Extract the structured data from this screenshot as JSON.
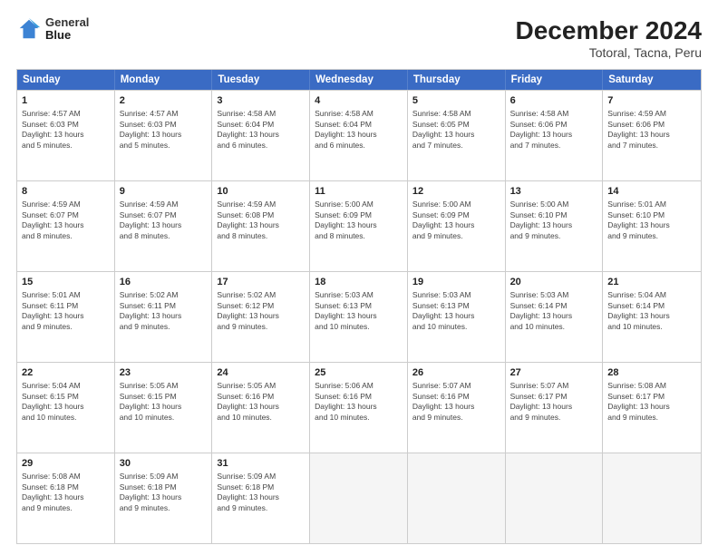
{
  "header": {
    "logo_line1": "General",
    "logo_line2": "Blue",
    "title": "December 2024",
    "subtitle": "Totoral, Tacna, Peru"
  },
  "weekdays": [
    "Sunday",
    "Monday",
    "Tuesday",
    "Wednesday",
    "Thursday",
    "Friday",
    "Saturday"
  ],
  "rows": [
    [
      {
        "day": "1",
        "lines": [
          "Sunrise: 4:57 AM",
          "Sunset: 6:03 PM",
          "Daylight: 13 hours",
          "and 5 minutes."
        ]
      },
      {
        "day": "2",
        "lines": [
          "Sunrise: 4:57 AM",
          "Sunset: 6:03 PM",
          "Daylight: 13 hours",
          "and 5 minutes."
        ]
      },
      {
        "day": "3",
        "lines": [
          "Sunrise: 4:58 AM",
          "Sunset: 6:04 PM",
          "Daylight: 13 hours",
          "and 6 minutes."
        ]
      },
      {
        "day": "4",
        "lines": [
          "Sunrise: 4:58 AM",
          "Sunset: 6:04 PM",
          "Daylight: 13 hours",
          "and 6 minutes."
        ]
      },
      {
        "day": "5",
        "lines": [
          "Sunrise: 4:58 AM",
          "Sunset: 6:05 PM",
          "Daylight: 13 hours",
          "and 7 minutes."
        ]
      },
      {
        "day": "6",
        "lines": [
          "Sunrise: 4:58 AM",
          "Sunset: 6:06 PM",
          "Daylight: 13 hours",
          "and 7 minutes."
        ]
      },
      {
        "day": "7",
        "lines": [
          "Sunrise: 4:59 AM",
          "Sunset: 6:06 PM",
          "Daylight: 13 hours",
          "and 7 minutes."
        ]
      }
    ],
    [
      {
        "day": "8",
        "lines": [
          "Sunrise: 4:59 AM",
          "Sunset: 6:07 PM",
          "Daylight: 13 hours",
          "and 8 minutes."
        ]
      },
      {
        "day": "9",
        "lines": [
          "Sunrise: 4:59 AM",
          "Sunset: 6:07 PM",
          "Daylight: 13 hours",
          "and 8 minutes."
        ]
      },
      {
        "day": "10",
        "lines": [
          "Sunrise: 4:59 AM",
          "Sunset: 6:08 PM",
          "Daylight: 13 hours",
          "and 8 minutes."
        ]
      },
      {
        "day": "11",
        "lines": [
          "Sunrise: 5:00 AM",
          "Sunset: 6:09 PM",
          "Daylight: 13 hours",
          "and 8 minutes."
        ]
      },
      {
        "day": "12",
        "lines": [
          "Sunrise: 5:00 AM",
          "Sunset: 6:09 PM",
          "Daylight: 13 hours",
          "and 9 minutes."
        ]
      },
      {
        "day": "13",
        "lines": [
          "Sunrise: 5:00 AM",
          "Sunset: 6:10 PM",
          "Daylight: 13 hours",
          "and 9 minutes."
        ]
      },
      {
        "day": "14",
        "lines": [
          "Sunrise: 5:01 AM",
          "Sunset: 6:10 PM",
          "Daylight: 13 hours",
          "and 9 minutes."
        ]
      }
    ],
    [
      {
        "day": "15",
        "lines": [
          "Sunrise: 5:01 AM",
          "Sunset: 6:11 PM",
          "Daylight: 13 hours",
          "and 9 minutes."
        ]
      },
      {
        "day": "16",
        "lines": [
          "Sunrise: 5:02 AM",
          "Sunset: 6:11 PM",
          "Daylight: 13 hours",
          "and 9 minutes."
        ]
      },
      {
        "day": "17",
        "lines": [
          "Sunrise: 5:02 AM",
          "Sunset: 6:12 PM",
          "Daylight: 13 hours",
          "and 9 minutes."
        ]
      },
      {
        "day": "18",
        "lines": [
          "Sunrise: 5:03 AM",
          "Sunset: 6:13 PM",
          "Daylight: 13 hours",
          "and 10 minutes."
        ]
      },
      {
        "day": "19",
        "lines": [
          "Sunrise: 5:03 AM",
          "Sunset: 6:13 PM",
          "Daylight: 13 hours",
          "and 10 minutes."
        ]
      },
      {
        "day": "20",
        "lines": [
          "Sunrise: 5:03 AM",
          "Sunset: 6:14 PM",
          "Daylight: 13 hours",
          "and 10 minutes."
        ]
      },
      {
        "day": "21",
        "lines": [
          "Sunrise: 5:04 AM",
          "Sunset: 6:14 PM",
          "Daylight: 13 hours",
          "and 10 minutes."
        ]
      }
    ],
    [
      {
        "day": "22",
        "lines": [
          "Sunrise: 5:04 AM",
          "Sunset: 6:15 PM",
          "Daylight: 13 hours",
          "and 10 minutes."
        ]
      },
      {
        "day": "23",
        "lines": [
          "Sunrise: 5:05 AM",
          "Sunset: 6:15 PM",
          "Daylight: 13 hours",
          "and 10 minutes."
        ]
      },
      {
        "day": "24",
        "lines": [
          "Sunrise: 5:05 AM",
          "Sunset: 6:16 PM",
          "Daylight: 13 hours",
          "and 10 minutes."
        ]
      },
      {
        "day": "25",
        "lines": [
          "Sunrise: 5:06 AM",
          "Sunset: 6:16 PM",
          "Daylight: 13 hours",
          "and 10 minutes."
        ]
      },
      {
        "day": "26",
        "lines": [
          "Sunrise: 5:07 AM",
          "Sunset: 6:16 PM",
          "Daylight: 13 hours",
          "and 9 minutes."
        ]
      },
      {
        "day": "27",
        "lines": [
          "Sunrise: 5:07 AM",
          "Sunset: 6:17 PM",
          "Daylight: 13 hours",
          "and 9 minutes."
        ]
      },
      {
        "day": "28",
        "lines": [
          "Sunrise: 5:08 AM",
          "Sunset: 6:17 PM",
          "Daylight: 13 hours",
          "and 9 minutes."
        ]
      }
    ],
    [
      {
        "day": "29",
        "lines": [
          "Sunrise: 5:08 AM",
          "Sunset: 6:18 PM",
          "Daylight: 13 hours",
          "and 9 minutes."
        ]
      },
      {
        "day": "30",
        "lines": [
          "Sunrise: 5:09 AM",
          "Sunset: 6:18 PM",
          "Daylight: 13 hours",
          "and 9 minutes."
        ]
      },
      {
        "day": "31",
        "lines": [
          "Sunrise: 5:09 AM",
          "Sunset: 6:18 PM",
          "Daylight: 13 hours",
          "and 9 minutes."
        ]
      },
      {
        "day": "",
        "lines": []
      },
      {
        "day": "",
        "lines": []
      },
      {
        "day": "",
        "lines": []
      },
      {
        "day": "",
        "lines": []
      }
    ]
  ]
}
